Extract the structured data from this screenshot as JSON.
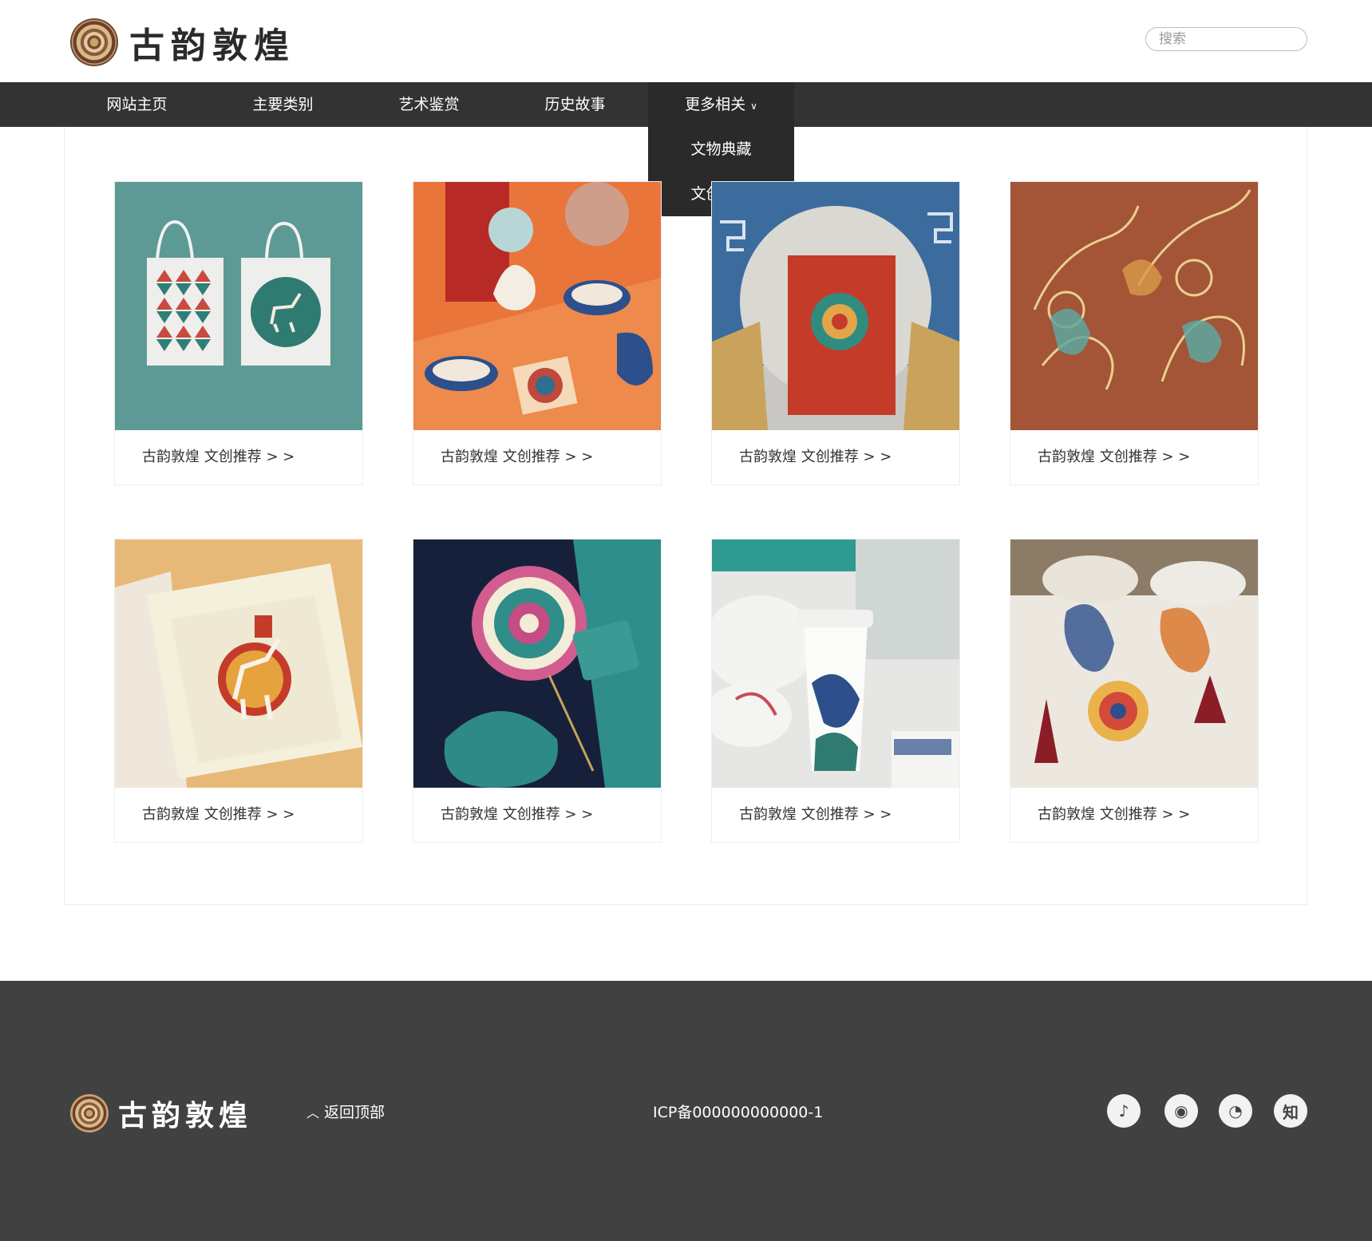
{
  "header": {
    "logo_text": "古韵敦煌",
    "search_placeholder": "搜索"
  },
  "nav": {
    "items": [
      {
        "label": "网站主页"
      },
      {
        "label": "主要类别"
      },
      {
        "label": "艺术鉴赏"
      },
      {
        "label": "历史故事"
      },
      {
        "label": "更多相关"
      }
    ],
    "dropdown": [
      {
        "label": "文物典藏"
      },
      {
        "label": "文创精品"
      }
    ]
  },
  "cards": [
    {
      "caption": "古韵敦煌 文创推荐 > >",
      "image": "tote-bags-on-teal"
    },
    {
      "caption": "古韵敦煌 文创推荐 > >",
      "image": "deer-acrylic-stands-on-orange"
    },
    {
      "caption": "古韵敦煌 文创推荐 > >",
      "image": "red-gift-box-on-blue"
    },
    {
      "caption": "古韵敦煌 文创推荐 > >",
      "image": "golden-flying-apsara-bookmarks"
    },
    {
      "caption": "古韵敦煌 文创推荐 > >",
      "image": "deer-pin-in-gift-box"
    },
    {
      "caption": "古韵敦煌 文创推荐 > >",
      "image": "mandala-fan-on-navy"
    },
    {
      "caption": "古韵敦煌 文创推荐 > >",
      "image": "apsara-cup"
    },
    {
      "caption": "古韵敦煌 文创推荐 > >",
      "image": "apsara-bookmarks-with-tassel"
    }
  ],
  "footer": {
    "logo_text": "古韵敦煌",
    "back_to_top": "返回顶部",
    "icp": "ICP备000000000000-1",
    "social": [
      {
        "name": "douyin-icon",
        "glyph": "♪"
      },
      {
        "name": "weibo-icon",
        "glyph": "◉"
      },
      {
        "name": "wechat-icon",
        "glyph": "◔"
      },
      {
        "name": "zhihu-icon",
        "glyph": "知"
      }
    ]
  },
  "colors": {
    "nav_bg": "#333333",
    "nav_active_bg": "#2a2a2a",
    "footer_bg": "#414141"
  }
}
